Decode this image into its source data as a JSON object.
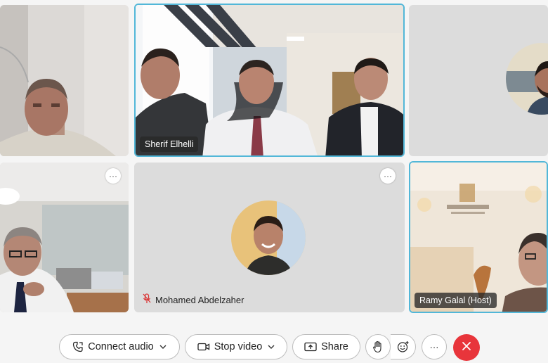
{
  "participants": [
    {
      "id": "p1",
      "name": "",
      "state": "video"
    },
    {
      "id": "p2",
      "name": "Sherif Elhelli",
      "state": "video",
      "active_speaker": true
    },
    {
      "id": "p3",
      "name": "",
      "state": "avatar"
    },
    {
      "id": "p4",
      "name": "",
      "state": "video",
      "more": "···"
    },
    {
      "id": "p5",
      "name": "Mohamed Abdelzaher",
      "state": "avatar",
      "muted": true,
      "more": "···"
    },
    {
      "id": "p6",
      "name": "Ramy Galal (Host)",
      "state": "video",
      "active_speaker": true
    }
  ],
  "toolbar": {
    "connect_audio": "Connect audio",
    "stop_video": "Stop video",
    "share": "Share",
    "more": "···"
  },
  "icons": {
    "connect_audio": "phone-arrow-icon",
    "stop_video": "video-camera-icon",
    "share": "share-screen-icon",
    "raise_hand": "raise-hand-icon",
    "reactions": "smile-plus-icon",
    "end_call": "close-icon",
    "muted": "mic-off-icon"
  },
  "colors": {
    "active_border": "#52b7d8",
    "end_call": "#e8353b",
    "tile_placeholder": "#dcdcdc",
    "mute_red": "#d93838"
  }
}
